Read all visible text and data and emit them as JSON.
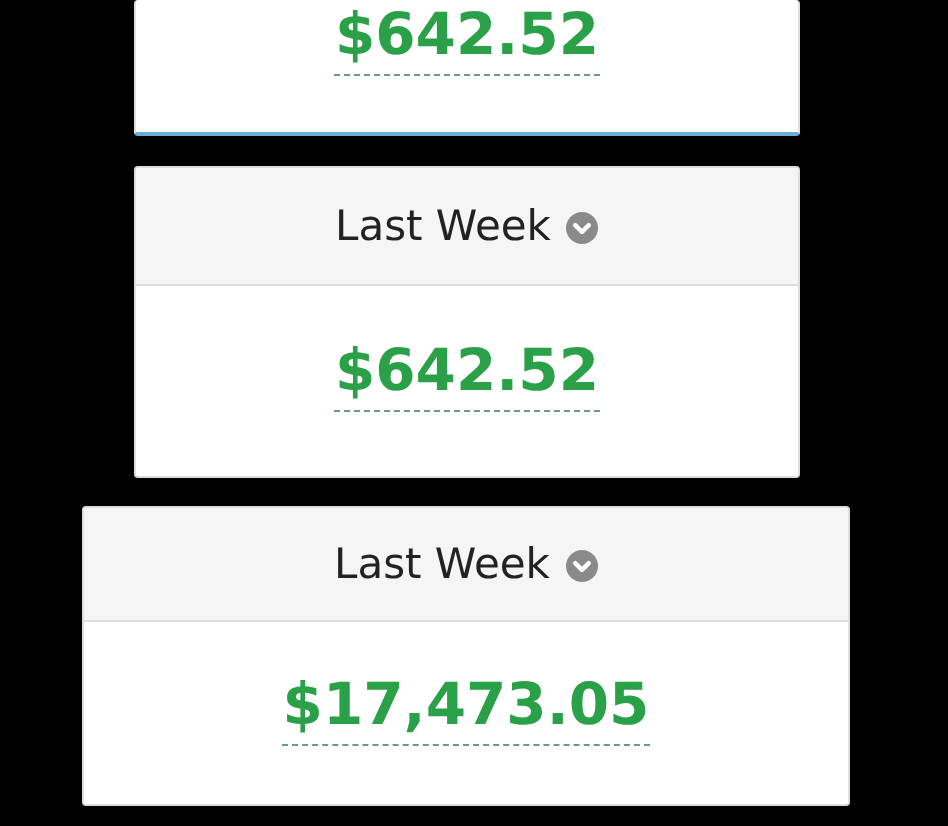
{
  "cards": [
    {
      "kind": "partial",
      "amount": "$642.52"
    },
    {
      "kind": "standard",
      "period": "Last Week",
      "amount": "$642.52"
    },
    {
      "kind": "large",
      "period": "Last Week",
      "amount": "$17,473.05"
    }
  ]
}
